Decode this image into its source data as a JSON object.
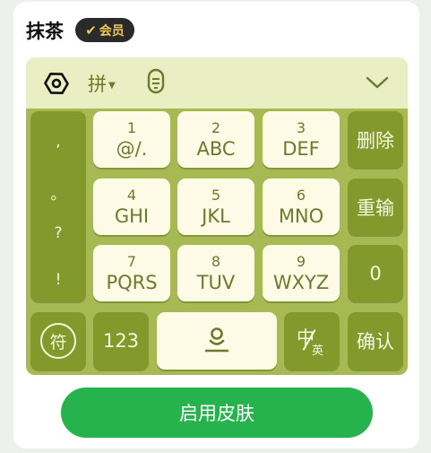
{
  "header": {
    "title": "抹茶",
    "vip_badge": "会员"
  },
  "toolbar": {
    "input_mode": "拼"
  },
  "keys": {
    "punct": [
      ",",
      "。",
      "?",
      "!"
    ],
    "grid": [
      {
        "num": "1",
        "letters": "@/."
      },
      {
        "num": "2",
        "letters": "ABC"
      },
      {
        "num": "3",
        "letters": "DEF"
      },
      {
        "num": "4",
        "letters": "GHI"
      },
      {
        "num": "5",
        "letters": "JKL"
      },
      {
        "num": "6",
        "letters": "MNO"
      },
      {
        "num": "7",
        "letters": "PQRS"
      },
      {
        "num": "8",
        "letters": "TUV"
      },
      {
        "num": "9",
        "letters": "WXYZ"
      }
    ],
    "delete": "删除",
    "reenter": "重输",
    "zero": "0",
    "symbol": "符",
    "numeric": "123",
    "lang_main": "中",
    "lang_sub": "英",
    "confirm": "确认"
  },
  "action": {
    "apply_label": "启用皮肤"
  },
  "colors": {
    "keyboard_bg": "#a7b952",
    "toolbar_bg": "#e9efc3",
    "key_light": "#fdfbe6",
    "key_dark": "#84992c",
    "cta": "#26b24d"
  }
}
